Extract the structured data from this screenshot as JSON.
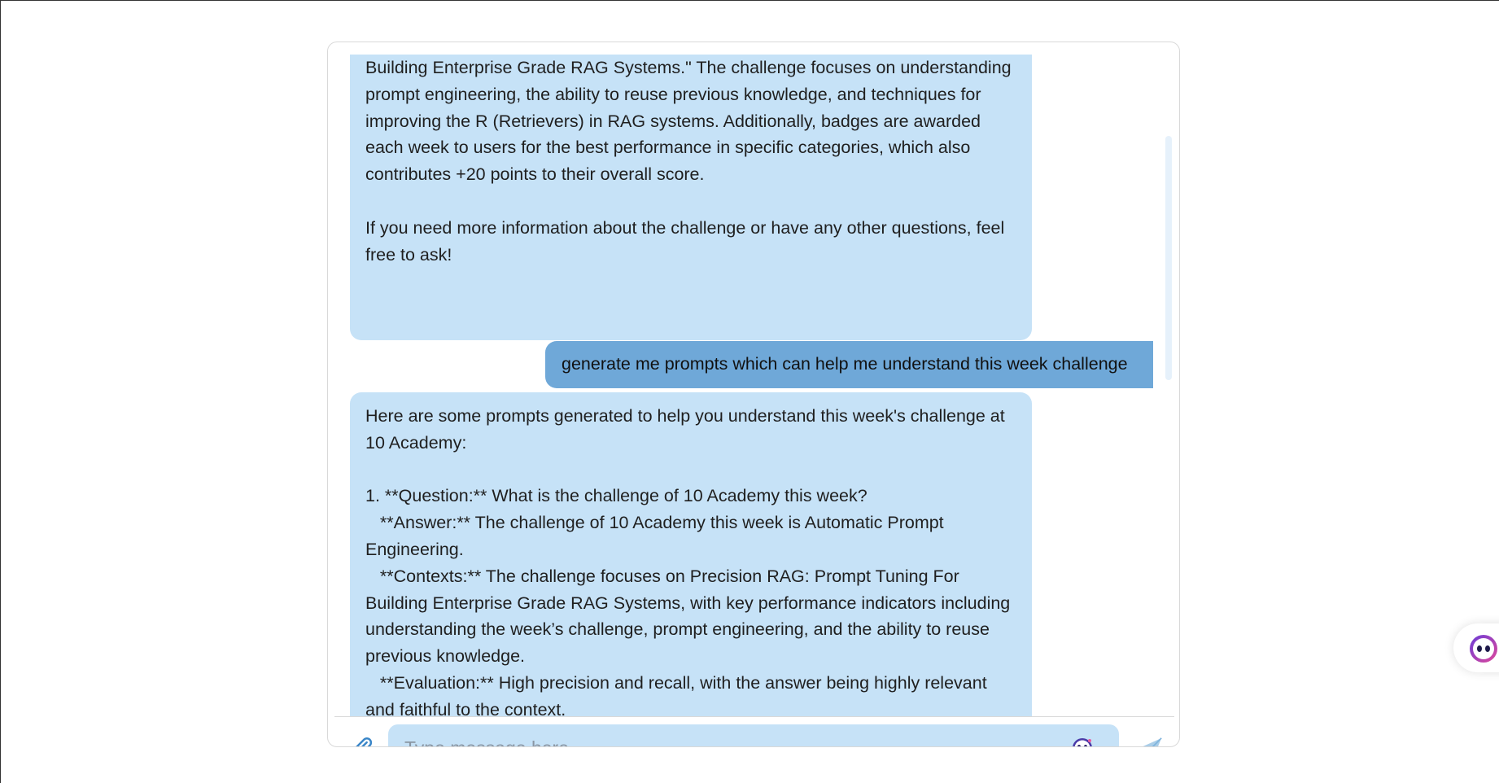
{
  "chat": {
    "messages": [
      {
        "role": "bot",
        "text": "Building Enterprise Grade RAG Systems.\" The challenge focuses on understanding prompt engineering, the ability to reuse previous knowledge, and techniques for improving the R (Retrievers) in RAG systems. Additionally, badges are awarded each week to users for the best performance in specific categories, which also contributes +20 points to their overall score.\n\nIf you need more information about the challenge or have any other questions, feel free to ask!"
      },
      {
        "role": "user",
        "text": "generate me prompts which can help me understand this week challenge"
      },
      {
        "role": "bot",
        "text": "Here are some prompts generated to help you understand this week's challenge at 10 Academy:\n\n1. **Question:** What is the challenge of 10 Academy this week?\n   **Answer:** The challenge of 10 Academy this week is Automatic Prompt Engineering.\n   **Contexts:** The challenge focuses on Precision RAG: Prompt Tuning For Building Enterprise Grade RAG Systems, with key performance indicators including understanding the week’s challenge, prompt engineering, and the ability to reuse previous knowledge.\n   **Evaluation:** High precision and recall, with the answer being highly relevant and faithful to the context."
      }
    ]
  },
  "composer": {
    "placeholder": "Type message here",
    "value": ""
  },
  "icons": {
    "attach": "paperclip-icon",
    "send": "send-icon",
    "bot": "bot-avatar-icon"
  },
  "colors": {
    "bot_bubble": "#c6e2f7",
    "user_bubble": "#6fa8d8",
    "accent": "#3a86c8"
  }
}
